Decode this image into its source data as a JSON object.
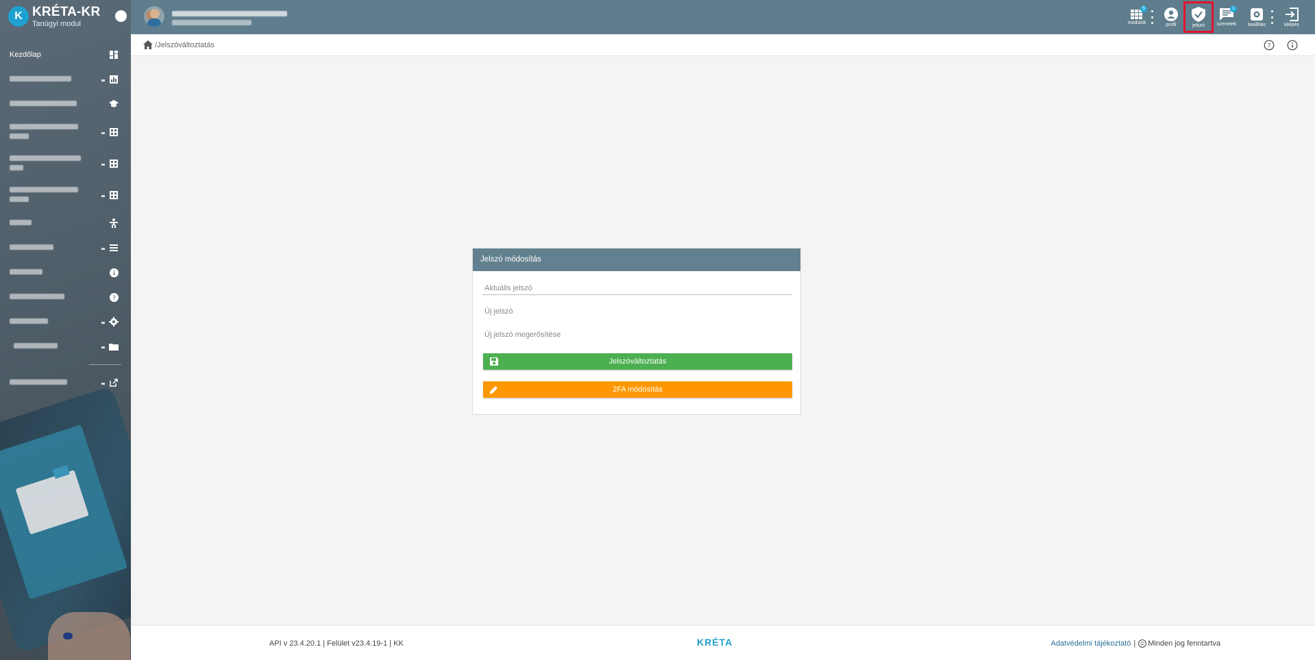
{
  "brand": {
    "logo_letter": "K",
    "title": "KRÉTA-KR",
    "subtitle": "Tanügyi modul"
  },
  "sidebar": {
    "items": [
      {
        "label": "Kezdőlap",
        "icon": "dashboard-icon"
      },
      {
        "label": "",
        "icon": "chart-icon"
      },
      {
        "label": "",
        "icon": "school-icon"
      },
      {
        "label": "",
        "icon": "table-icon"
      },
      {
        "label": "",
        "icon": "table-icon"
      },
      {
        "label": "",
        "icon": "table-icon"
      },
      {
        "label": "",
        "icon": "accessibility-icon"
      },
      {
        "label": "",
        "icon": "list-icon"
      },
      {
        "label": "",
        "icon": "info-icon"
      },
      {
        "label": "",
        "icon": "help-icon"
      },
      {
        "label": "",
        "icon": "gear-icon"
      },
      {
        "label": "",
        "icon": "folder-icon"
      },
      {
        "label": "",
        "icon": "external-link-icon"
      }
    ]
  },
  "topbar": {
    "buttons": [
      {
        "label": "modulok",
        "badge": "5",
        "icon": "grid-icon"
      },
      {
        "label": "profil",
        "icon": "account-icon"
      },
      {
        "label": "jelszó",
        "icon": "shield-check-icon"
      },
      {
        "label": "üzenetek",
        "badge": "1",
        "icon": "message-icon"
      },
      {
        "label": "beállítás",
        "icon": "gear-icon"
      },
      {
        "label": "kilépés",
        "icon": "logout-icon"
      }
    ],
    "highlight_color": "#e3132a"
  },
  "breadcrumb": {
    "current": "Jelszóváltoztatás"
  },
  "form": {
    "title": "Jelszó módosítás",
    "current_password_placeholder": "Aktuális jelszó",
    "new_password_placeholder": "Új jelszó",
    "confirm_password_placeholder": "Új jelszó megerősítése",
    "save_button": "Jelszóváltoztatás",
    "twofa_button": "2FA módosítás"
  },
  "footer": {
    "versions": "API v 23.4.20.1 | Felület v23.4.19-1 | KK",
    "logo": "KRÉTA",
    "privacy_link": "Adatvédelmi tájékoztató",
    "separator": "|",
    "copyright_symbol": "©",
    "rights": "Minden jog fenntartva"
  },
  "colors": {
    "topbar": "#5f7d8c",
    "card_header": "#62808f",
    "green": "#4caf50",
    "orange": "#ff9800",
    "accent": "#1ea0d0"
  }
}
